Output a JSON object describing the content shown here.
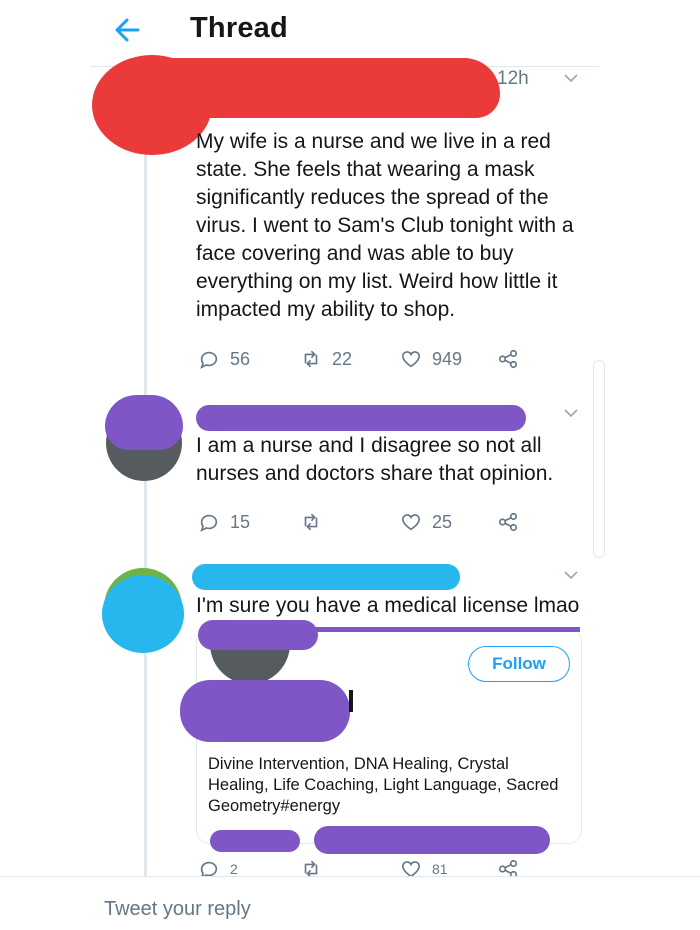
{
  "header": {
    "title": "Thread",
    "back_icon": "arrow-left-icon"
  },
  "tweets": [
    {
      "time": "12h",
      "text": "My wife is a nurse and we live in a red state. She feels that wearing a mask significantly reduces the spread of the virus. I went to Sam's Club tonight with a face covering and was able to buy everything on my list. Weird how little it impacted my ability to shop.",
      "replies": "56",
      "retweets": "22",
      "likes": "949"
    },
    {
      "text": "I am a nurse and I disagree so not all nurses and doctors share that opinion.",
      "replies": "15",
      "retweets": "",
      "likes": "25"
    },
    {
      "text": "I'm sure you have a medical license lmao",
      "card": {
        "follow_label": "Follow",
        "bio": "Divine Intervention, DNA Healing, Crystal Healing, Life Coaching, Light Language, Sacred Geometry#energy"
      },
      "replies": "2",
      "likes": "81"
    }
  ],
  "reply_box": {
    "placeholder": "Tweet your reply"
  },
  "colors": {
    "accent": "#1da1f2",
    "text": "#14171a",
    "muted": "#657786",
    "redact_red": "#ea3a3a",
    "redact_purple": "#7e56c6",
    "redact_blue": "#27b7ee"
  }
}
